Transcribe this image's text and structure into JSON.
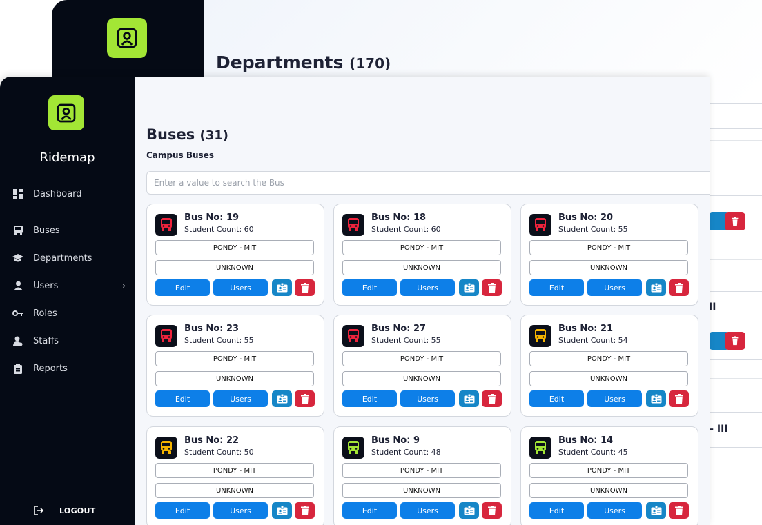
{
  "back": {
    "title": "Departments",
    "count": "(170)",
    "row_labels": [
      "II",
      "– III"
    ]
  },
  "app": {
    "name": "Ridemap"
  },
  "sidebar": {
    "items": [
      {
        "label": "Dashboard",
        "icon": "dashboard-icon"
      },
      {
        "label": "Buses",
        "icon": "bus-icon"
      },
      {
        "label": "Departments",
        "icon": "graduation-cap-icon"
      },
      {
        "label": "Users",
        "icon": "user-icon",
        "chevron": "›"
      },
      {
        "label": "Roles",
        "icon": "key-icon"
      },
      {
        "label": "Staffs",
        "icon": "staff-icon"
      },
      {
        "label": "Reports",
        "icon": "clipboard-icon"
      }
    ],
    "logout": "LOGOUT"
  },
  "page": {
    "title": "Buses",
    "count": "(31)",
    "subtitle": "Campus Buses",
    "search_placeholder": "Enter a value to search the Bus"
  },
  "labels": {
    "edit": "Edit",
    "users": "Users"
  },
  "colors": {
    "accent": "#a3e635",
    "sidebar_bg": "#050a15",
    "primary_button": "#0d7fe8",
    "id_button": "#1686c7",
    "delete_button": "#d7263d",
    "bus_red": "#ef233c",
    "bus_yellow": "#f5b400",
    "bus_green": "#a3e635"
  },
  "buses": [
    {
      "bus_no": "Bus No: 19",
      "count": "Student Count: 60",
      "route": "PONDY - MIT",
      "status": "UNKNOWN",
      "icon_color": "#ef233c"
    },
    {
      "bus_no": "Bus No: 18",
      "count": "Student Count: 60",
      "route": "PONDY - MIT",
      "status": "UNKNOWN",
      "icon_color": "#ef233c"
    },
    {
      "bus_no": "Bus No: 20",
      "count": "Student Count: 55",
      "route": "PONDY - MIT",
      "status": "UNKNOWN",
      "icon_color": "#ef233c"
    },
    {
      "bus_no": "Bus No: 23",
      "count": "Student Count: 55",
      "route": "PONDY - MIT",
      "status": "UNKNOWN",
      "icon_color": "#ef233c"
    },
    {
      "bus_no": "Bus No: 27",
      "count": "Student Count: 55",
      "route": "PONDY - MIT",
      "status": "UNKNOWN",
      "icon_color": "#ef233c"
    },
    {
      "bus_no": "Bus No: 21",
      "count": "Student Count: 54",
      "route": "PONDY - MIT",
      "status": "UNKNOWN",
      "icon_color": "#f5b400"
    },
    {
      "bus_no": "Bus No: 22",
      "count": "Student Count: 50",
      "route": "PONDY - MIT",
      "status": "UNKNOWN",
      "icon_color": "#f5b400"
    },
    {
      "bus_no": "Bus No: 9",
      "count": "Student Count: 48",
      "route": "PONDY - MIT",
      "status": "UNKNOWN",
      "icon_color": "#a3e635"
    },
    {
      "bus_no": "Bus No: 14",
      "count": "Student Count: 45",
      "route": "PONDY - MIT",
      "status": "UNKNOWN",
      "icon_color": "#a3e635"
    }
  ]
}
